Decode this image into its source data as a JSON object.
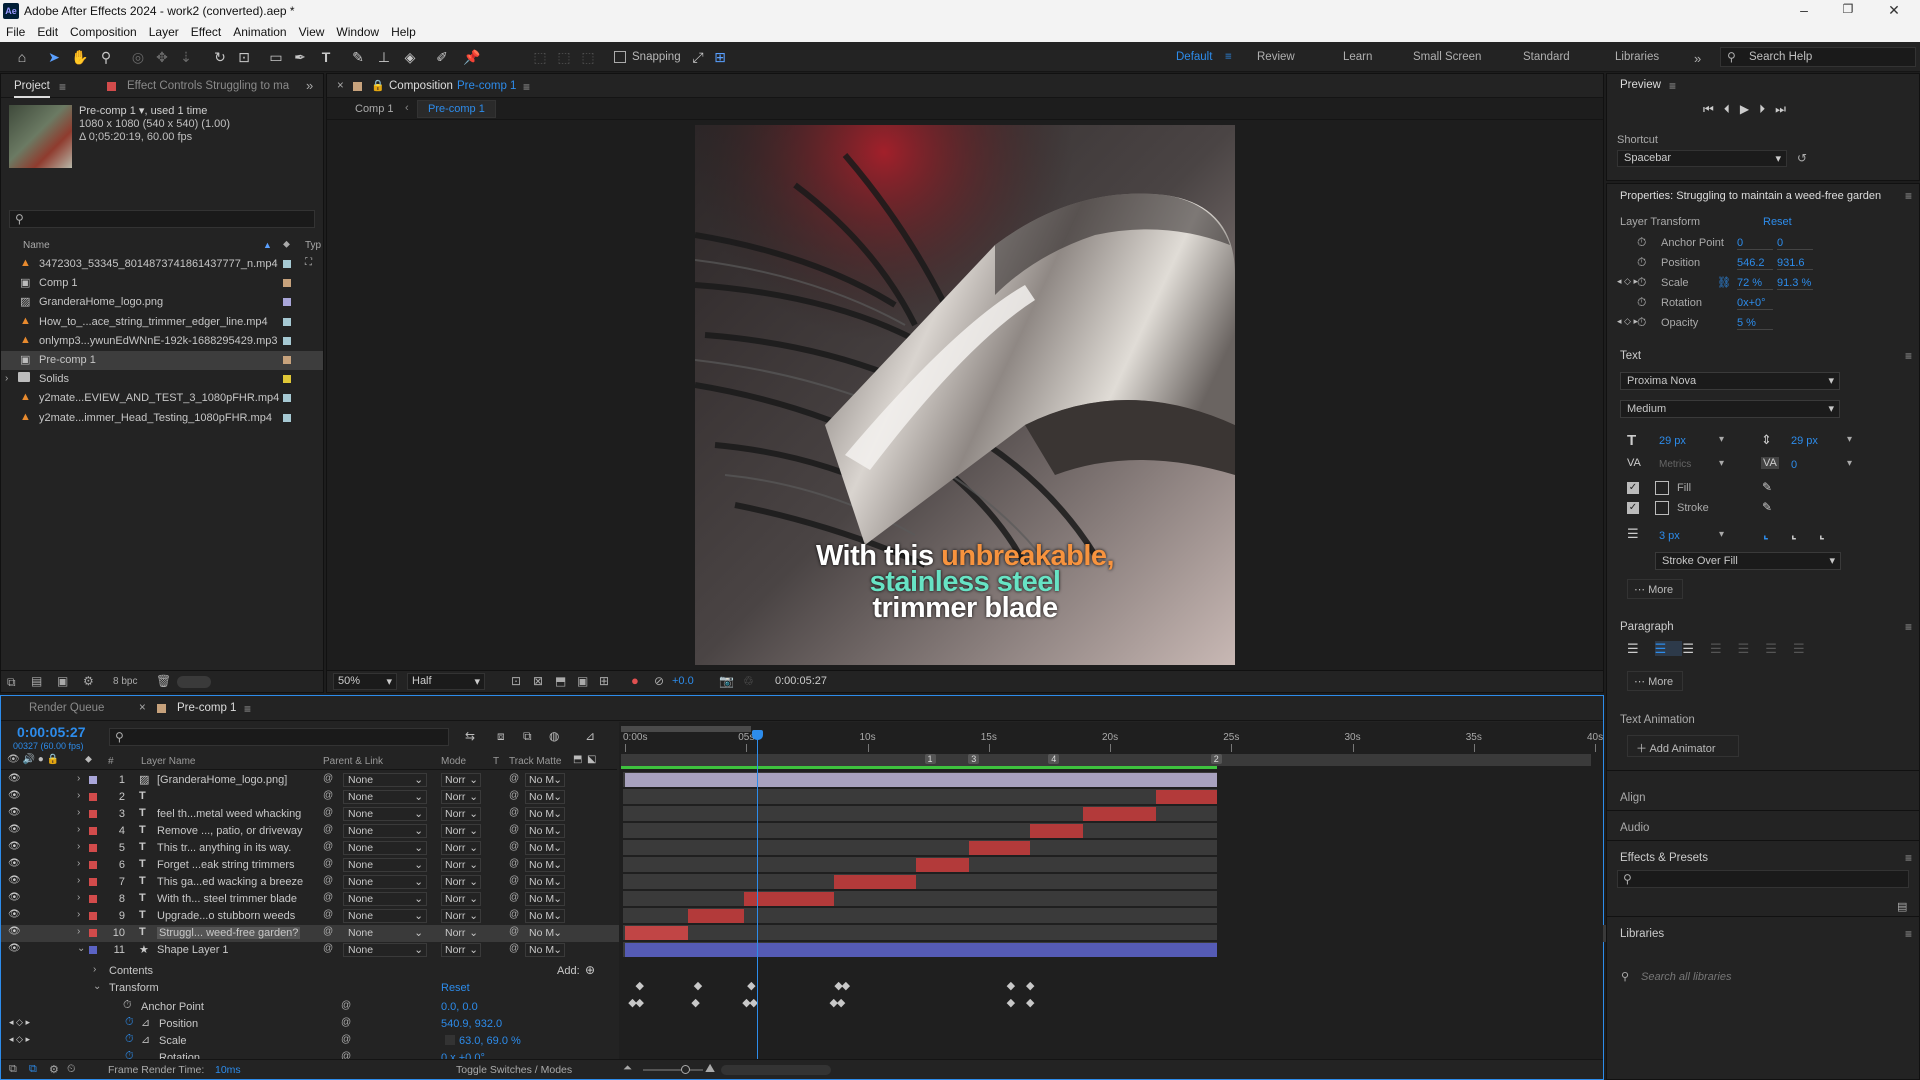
{
  "app": {
    "title": "Adobe After Effects 2024 - work2 (converted).aep *",
    "logo": "Ae"
  },
  "menu": [
    "File",
    "Edit",
    "Composition",
    "Layer",
    "Effect",
    "Animation",
    "View",
    "Window",
    "Help"
  ],
  "toolbar": {
    "snapping_label": "Snapping",
    "workspaces": [
      "Default",
      "Review",
      "Learn",
      "Small Screen",
      "Standard",
      "Libraries"
    ],
    "active_workspace": "Default",
    "search_placeholder": "Search Help"
  },
  "project": {
    "tab_label": "Project",
    "effect_controls_label": "Effect Controls Struggling to ma",
    "item_name": "Pre-comp 1",
    "item_used": ", used 1 time",
    "item_dims": "1080 x 1080  (540 x 540) (1.00)",
    "item_duration": "Δ 0;05:20:19, 60.00 fps",
    "col_name": "Name",
    "col_type": "Typ",
    "bpc": "8 bpc",
    "items": [
      {
        "name": "3472303_53345_8014873741861437777_n.mp4",
        "icon": "video-icon",
        "color": "#a6c9d3"
      },
      {
        "name": "Comp 1",
        "icon": "comp-icon",
        "color": "#c7a27c"
      },
      {
        "name": "GranderaHome_logo.png",
        "icon": "image-icon",
        "color": "#a9a6d9"
      },
      {
        "name": "How_to_...ace_string_trimmer_edger_line.mp4",
        "icon": "video-icon",
        "color": "#a6c9d3"
      },
      {
        "name": "onlymp3...ywunEdWNnE-192k-1688295429.mp3",
        "icon": "audio-icon",
        "color": "#a6c9d3"
      },
      {
        "name": "Pre-comp 1",
        "icon": "comp-icon",
        "color": "#c7a27c"
      },
      {
        "name": "Solids",
        "icon": "folder-icon",
        "color": "#e0c837"
      },
      {
        "name": "y2mate...EVIEW_AND_TEST_3_1080pFHR.mp4",
        "icon": "video-icon",
        "color": "#a6c9d3"
      },
      {
        "name": "y2mate...immer_Head_Testing_1080pFHR.mp4",
        "icon": "video-icon",
        "color": "#a6c9d3"
      }
    ]
  },
  "composition": {
    "panel_label": "Composition",
    "comp_name": "Pre-comp 1",
    "breadcrumb": [
      "Comp 1",
      "Pre-comp 1"
    ],
    "caption_line1_white": "With this ",
    "caption_line1_orange": "unbreakable,",
    "caption_line2": "stainless steel",
    "caption_line3": "trimmer blade",
    "zoom": "50%",
    "resolution": "Half",
    "exposure": "+0.0",
    "timecode": "0:00:05:27",
    "orange": "#f7933e",
    "teal": "#67e3c4"
  },
  "preview": {
    "title": "Preview",
    "shortcut_label": "Shortcut",
    "shortcut_value": "Spacebar"
  },
  "properties": {
    "title": "Properties: Struggling to maintain a weed-free garden",
    "layer_transform": "Layer Transform",
    "reset": "Reset",
    "rows": [
      {
        "label": "Anchor Point",
        "v1": "0",
        "v2": "0"
      },
      {
        "label": "Position",
        "v1": "546.2",
        "v2": "931.6"
      },
      {
        "label": "Scale",
        "v1": "72 %",
        "v2": "91.3 %"
      },
      {
        "label": "Rotation",
        "v1": "0x+0°",
        "v2": ""
      },
      {
        "label": "Opacity",
        "v1": "5 %",
        "v2": ""
      }
    ],
    "text_title": "Text",
    "font": "Proxima Nova",
    "weight": "Medium",
    "size": "29 px",
    "leading": "29 px",
    "kerning": "Metrics",
    "tracking": "0",
    "fill": "Fill",
    "stroke": "Stroke",
    "stroke_width": "3 px",
    "stroke_mode": "Stroke Over Fill",
    "more": "More",
    "paragraph_title": "Paragraph",
    "text_animation": "Text Animation",
    "add_animator": "Add Animator",
    "align": "Align",
    "audio": "Audio",
    "effects_presets": "Effects & Presets",
    "libraries": "Libraries",
    "libraries_search": "Search all libraries"
  },
  "timeline": {
    "render_queue": "Render Queue",
    "comp_tab": "Pre-comp 1",
    "timecode": "0:00:05:27",
    "frames": "00327 (60.00 fps)",
    "col_layer_name": "Layer Name",
    "col_parent": "Parent & Link",
    "col_mode": "Mode",
    "col_t": "T",
    "col_matte": "Track Matte",
    "ruler": [
      "0:00s",
      "05s",
      "10s",
      "15s",
      "20s",
      "25s",
      "30s",
      "35s",
      "40s"
    ],
    "markers": [
      "1",
      "3",
      "4",
      "2"
    ],
    "layers": [
      {
        "num": "1",
        "type": "image",
        "name": "[GranderaHome_logo.png]",
        "color": "#a9a6d9",
        "start": 0,
        "end": 24.4,
        "bar": "#a8a2bf"
      },
      {
        "num": "2",
        "type": "T",
        "name": "",
        "color": "#d24b4b",
        "start": 21.9,
        "end": 24.4,
        "bar": "#b33a3a"
      },
      {
        "num": "3",
        "type": "T",
        "name": "feel th...metal weed whacking",
        "color": "#d24b4b",
        "start": 18.9,
        "end": 21.9,
        "bar": "#b33a3a"
      },
      {
        "num": "4",
        "type": "T",
        "name": "Remove ..., patio, or driveway",
        "color": "#d24b4b",
        "start": 16.7,
        "end": 18.9,
        "bar": "#b33a3a"
      },
      {
        "num": "5",
        "type": "T",
        "name": "This tr... anything in its way.",
        "color": "#d24b4b",
        "start": 14.2,
        "end": 16.7,
        "bar": "#b33a3a"
      },
      {
        "num": "6",
        "type": "T",
        "name": "Forget ...eak string trimmers",
        "color": "#d24b4b",
        "start": 12.0,
        "end": 14.2,
        "bar": "#b33a3a"
      },
      {
        "num": "7",
        "type": "T",
        "name": "This ga...ed wacking a breeze",
        "color": "#d24b4b",
        "start": 8.6,
        "end": 12.0,
        "bar": "#b33a3a"
      },
      {
        "num": "8",
        "type": "T",
        "name": "With th... steel trimmer blade",
        "color": "#d24b4b",
        "start": 4.9,
        "end": 8.6,
        "bar": "#b33a3a"
      },
      {
        "num": "9",
        "type": "T",
        "name": "Upgrade...o stubborn weeds",
        "color": "#d24b4b",
        "start": 2.6,
        "end": 4.9,
        "bar": "#b33a3a"
      },
      {
        "num": "10",
        "type": "T",
        "name": "Struggl... weed-free garden?",
        "color": "#d24b4b",
        "start": 0,
        "end": 2.6,
        "bar": "#c14545"
      },
      {
        "num": "11",
        "type": "shape",
        "name": "Shape Layer 1",
        "color": "#5b63c4",
        "start": 0,
        "end": 24.4,
        "bar": "#555bb5"
      }
    ],
    "parent_none": "None",
    "mode_norm": "Norr",
    "matte_no": "No M",
    "contents": "Contents",
    "transform": "Transform",
    "reset": "Reset",
    "add_label": "Add:",
    "props": [
      {
        "label": "Anchor Point",
        "value": "0.0, 0.0"
      },
      {
        "label": "Position",
        "value": "540.9, 932.0"
      },
      {
        "label": "Scale",
        "value": "63.0, 69.0 %"
      },
      {
        "label": "Rotation",
        "value": "0 x +0.0°"
      }
    ],
    "frame_render_label": "Frame Render Time:",
    "frame_render_value": "10ms",
    "toggle_switches": "Toggle Switches / Modes",
    "playhead_seconds": 5.45,
    "end_seconds": 24.4,
    "max_seconds": 40
  }
}
